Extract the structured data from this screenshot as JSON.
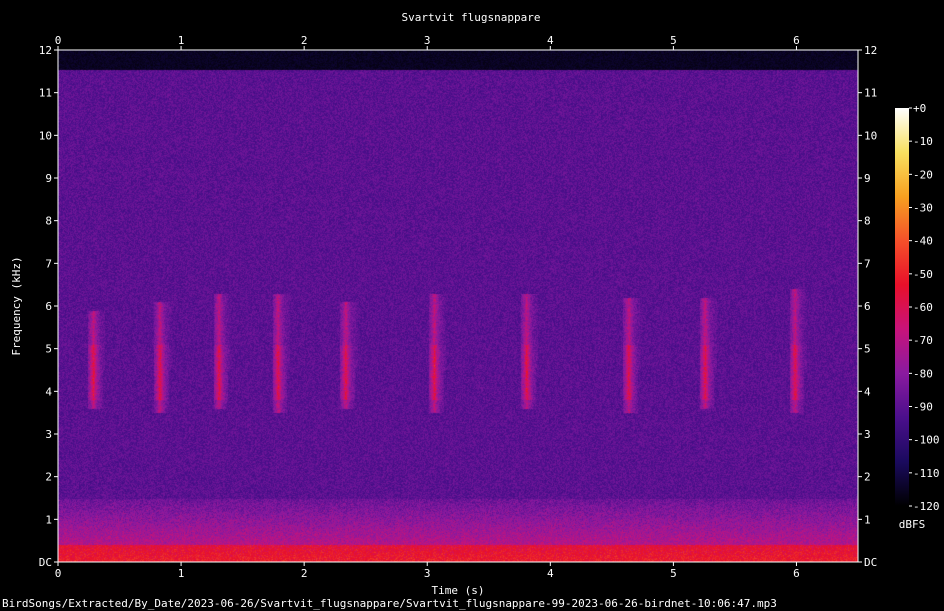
{
  "chart_data": {
    "type": "heatmap",
    "title": "Svartvit flugsnappare",
    "xlabel": "Time (s)",
    "ylabel": "Frequency (kHz)",
    "x_ticks": [
      "0",
      "1",
      "2",
      "3",
      "4",
      "5",
      "6"
    ],
    "y_ticks": [
      "DC",
      "1",
      "2",
      "3",
      "4",
      "5",
      "6",
      "7",
      "8",
      "9",
      "10",
      "11",
      "12"
    ],
    "xlim": [
      0,
      6.5
    ],
    "ylim": [
      0,
      12
    ],
    "colorbar": {
      "label": "dBFS",
      "ticks": [
        "+0",
        "-10",
        "-20",
        "-30",
        "-40",
        "-50",
        "-60",
        "-70",
        "-80",
        "-90",
        "-100",
        "-110",
        "-120"
      ],
      "range": [
        -120,
        0
      ],
      "colors": [
        "#000000",
        "#1a0a5e",
        "#4b0f8c",
        "#8a1aa0",
        "#c8137a",
        "#e8102a",
        "#f5502a",
        "#f7a020",
        "#f8e060",
        "#ffffff"
      ]
    },
    "background_color": "#2a0a66",
    "energy_top_khz": 11.55,
    "calls": [
      {
        "t": 0.28,
        "f_low": 3.6,
        "f_high": 5.9
      },
      {
        "t": 0.82,
        "f_low": 3.5,
        "f_high": 6.1
      },
      {
        "t": 1.3,
        "f_low": 3.6,
        "f_high": 6.3
      },
      {
        "t": 1.78,
        "f_low": 3.5,
        "f_high": 6.3
      },
      {
        "t": 2.33,
        "f_low": 3.6,
        "f_high": 6.1
      },
      {
        "t": 3.05,
        "f_low": 3.5,
        "f_high": 6.3
      },
      {
        "t": 3.8,
        "f_low": 3.6,
        "f_high": 6.3
      },
      {
        "t": 4.63,
        "f_low": 3.5,
        "f_high": 6.2
      },
      {
        "t": 5.25,
        "f_low": 3.6,
        "f_high": 6.2
      },
      {
        "t": 5.98,
        "f_low": 3.5,
        "f_high": 6.4
      }
    ]
  },
  "footer": {
    "path": "BirdSongs/Extracted/By_Date/2023-06-26/Svartvit_flugsnappare/Svartvit_flugsnappare-99-2023-06-26-birdnet-10:06:47.mp3"
  }
}
